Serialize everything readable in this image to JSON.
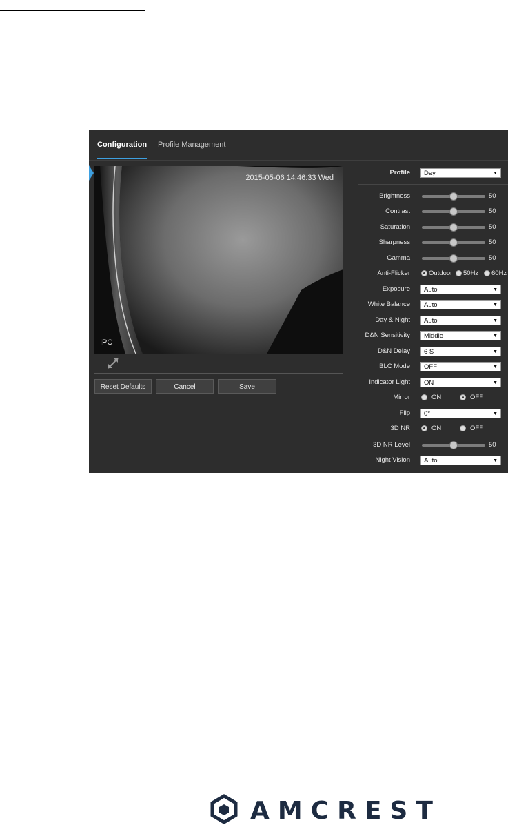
{
  "tabs": [
    {
      "label": "Configuration",
      "active": true
    },
    {
      "label": "Profile Management",
      "active": false
    }
  ],
  "video": {
    "timestamp": "2015-05-06 14:46:33 Wed",
    "osd_label": "IPC"
  },
  "buttons": {
    "reset": "Reset Defaults",
    "cancel": "Cancel",
    "save": "Save"
  },
  "settings": {
    "profile": {
      "label": "Profile",
      "value": "Day"
    },
    "brightness": {
      "label": "Brightness",
      "value": "50"
    },
    "contrast": {
      "label": "Contrast",
      "value": "50"
    },
    "saturation": {
      "label": "Saturation",
      "value": "50"
    },
    "sharpness": {
      "label": "Sharpness",
      "value": "50"
    },
    "gamma": {
      "label": "Gamma",
      "value": "50"
    },
    "anti_flicker": {
      "label": "Anti-Flicker",
      "options": [
        "Outdoor",
        "50Hz",
        "60Hz"
      ],
      "selected": "Outdoor"
    },
    "exposure": {
      "label": "Exposure",
      "value": "Auto"
    },
    "white_balance": {
      "label": "White Balance",
      "value": "Auto"
    },
    "day_night": {
      "label": "Day & Night",
      "value": "Auto"
    },
    "dn_sensitivity": {
      "label": "D&N Sensitivity",
      "value": "Middle"
    },
    "dn_delay": {
      "label": "D&N Delay",
      "value": "6 S"
    },
    "blc_mode": {
      "label": "BLC Mode",
      "value": "OFF"
    },
    "indicator_light": {
      "label": "Indicator Light",
      "value": "ON"
    },
    "mirror": {
      "label": "Mirror",
      "on": "ON",
      "off": "OFF",
      "selected": "OFF"
    },
    "flip": {
      "label": "Flip",
      "value": "0°"
    },
    "nr3d": {
      "label": "3D NR",
      "on": "ON",
      "off": "OFF",
      "selected": "ON"
    },
    "nr3d_level": {
      "label": "3D NR Level",
      "value": "50"
    },
    "night_vision": {
      "label": "Night Vision",
      "value": "Auto"
    }
  },
  "logo": {
    "text": "AMCREST",
    "color": "#1d2b41"
  },
  "colors": {
    "accent": "#3ea0e0",
    "panel_bg": "#2d2d2d"
  }
}
